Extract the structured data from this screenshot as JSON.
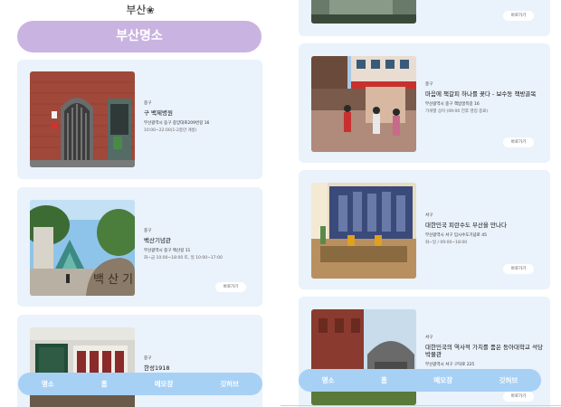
{
  "header": {
    "logo_text": "부산",
    "title": "부산명소"
  },
  "icons": {
    "logo": "flower-icon"
  },
  "colors": {
    "title_pill": "#c9b3e0",
    "card_bg": "#eaf2fb",
    "nav_bg": "#a7d0f5"
  },
  "left_cards": [
    {
      "district": "중구",
      "name": "구 백제병원",
      "address": "부산광역시 동구 중앙대로209번길 16",
      "hours": "10:00~22:00(1-2층만 개방)",
      "more": ""
    },
    {
      "district": "중구",
      "name": "백산기념관",
      "address": "부산광역시 중구 백산길 11",
      "hours": "화~금 10:00~18:00 토, 일 10:00~17:00",
      "more": "바로가기"
    },
    {
      "district": "중구",
      "name": "한성1918",
      "address": "",
      "hours": "",
      "more": ""
    }
  ],
  "right_cards": [
    {
      "district": "",
      "name": "",
      "address": "",
      "hours": "",
      "more": "바로가기"
    },
    {
      "district": "중구",
      "name": "마음에 책갈피 하나를 꽂다 - 보수동 책방골목",
      "address": "부산광역시 중구 책방골목길 16",
      "hours": "가게별 상이 (09:00 전후 영업 종료)",
      "more": "바로가기"
    },
    {
      "district": "서구",
      "name": "대한민국 피란수도 부산을 만나다",
      "address": "부산광역시 서구 임시수도기념로 45",
      "hours": "화~일 / 09:00~18:00",
      "more": "바로가기"
    },
    {
      "district": "서구",
      "name": "대한민국의 역사적 가치를 품은 동아대학교 석당박물관",
      "address": "부산광역시 서구 구덕로 225",
      "hours": "",
      "more": "바로가기"
    }
  ],
  "nav": {
    "tab1": "명소",
    "tab2": "홈",
    "tab3": "메모장",
    "tab4": "깃허브"
  }
}
